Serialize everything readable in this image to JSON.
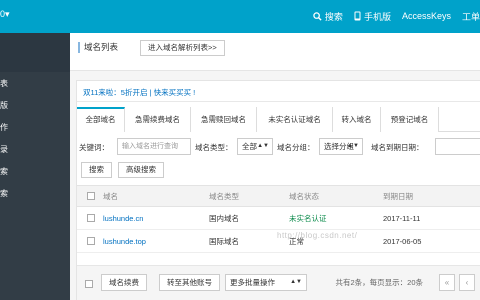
{
  "topbar": {
    "brand": "0▾",
    "nav": [
      {
        "icon": "search-icon",
        "label": "搜索"
      },
      {
        "icon": "mobile-icon",
        "label": "手机版"
      },
      {
        "icon": "",
        "label": "AccessKeys"
      },
      {
        "icon": "",
        "label": "工单"
      }
    ]
  },
  "sidebar": {
    "items": [
      {
        "label": "表"
      },
      {
        "label": "版"
      },
      {
        "label": "作"
      },
      {
        "label": "录"
      },
      {
        "label": "索"
      },
      {
        "label": "索"
      }
    ]
  },
  "header": {
    "title": "域名列表",
    "enter_button": "进入域名解析列表>>"
  },
  "promo": "双11来啦：5折开启 | 快来买买买 !",
  "tabs": [
    "全部域名",
    "急需续费域名",
    "急需赎回域名",
    "未实名认证域名",
    "转入域名",
    "预登记域名"
  ],
  "filters": {
    "keyword_label": "关键词：",
    "keyword_placeholder": "输入域名进行查询",
    "type_label": "域名类型：",
    "type_value": "全部",
    "group_label": "域名分组：",
    "group_value": "选择分组",
    "expiry_label": "域名到期日期："
  },
  "actions": {
    "search": "搜索",
    "advanced": "高级搜索"
  },
  "table": {
    "headers": [
      "域名",
      "域名类型",
      "域名状态",
      "到期日期"
    ],
    "rows": [
      {
        "domain": "lushunde.cn",
        "type": "国内域名",
        "status": "未实名认证",
        "expiry": "2017-11-11"
      },
      {
        "domain": "lushunde.top",
        "type": "国际域名",
        "status": "正常",
        "expiry": "2017-06-05"
      }
    ]
  },
  "bottom": {
    "renew_button": "域名续费",
    "transfer_button": "转至其他账号",
    "batch_value": "更多批量操作",
    "pager_text": "共有2条，每页显示：20条",
    "prev": "«",
    "prev2": "‹"
  },
  "watermark": "http://blog.csdn.net/"
}
